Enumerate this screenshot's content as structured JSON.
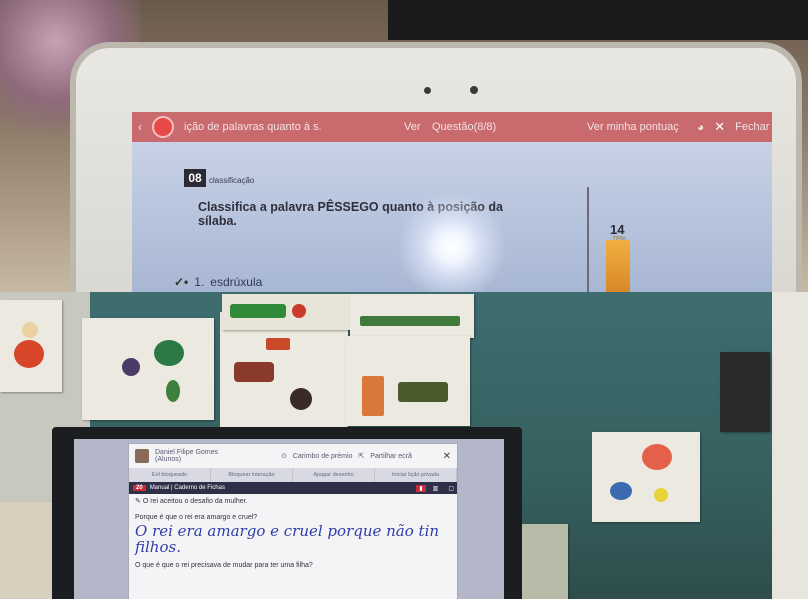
{
  "top_photo": {
    "screen_bar": {
      "title": "ição de palavras quanto à s.",
      "ver": "Ver",
      "question_counter": "Questão(8/8)",
      "score_link": "Ver minha pontuaç",
      "close_label": "Fechar"
    },
    "question": {
      "number": "08",
      "category": "classificação",
      "text": "Classifica a palavra PÊSSEGO quanto à posição da sílaba.",
      "answer_index": "1.",
      "answer_text": "esdrúxula"
    },
    "score": {
      "value": "14",
      "percent": "78%"
    }
  },
  "bottom_photo": {
    "app": {
      "user_name": "Daniel Filipe Gomes",
      "user_status": "(Alunos)",
      "header_link_1": "Carimbo de prémio",
      "header_link_2": "Partilhar ecrã",
      "tabs": [
        "Eril bloqueado",
        "Bloquear interação",
        "Apagar desenho",
        "Iniciar lição privada"
      ],
      "page_number": "20",
      "book_title": "Manual | Caderno de Fichas",
      "line_1": "O rei aceitou o desafio da mulher.",
      "question_1": "Porque é que o rei era amargo e cruel?",
      "answer_1": "O rei era amargo e cruel porque não tin filhos.",
      "question_2": "O que é que o rei precisava de mudar para ter uma filha?"
    }
  }
}
